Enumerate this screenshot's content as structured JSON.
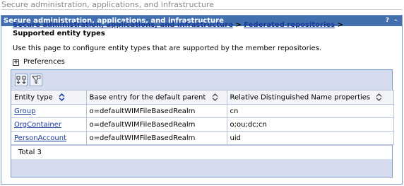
{
  "page": {
    "heading": "Secure administration, applications, and infrastructure"
  },
  "portlet": {
    "title": "Secure administration, applications, and infrastructure",
    "help_label": "?",
    "minimize_label": "–"
  },
  "breadcrumb": {
    "link1": "Secure administration, applications, and infrastructure",
    "sep1": " > ",
    "link2": "Federated repositories",
    "sep2": " > ",
    "current": "Supported entity types"
  },
  "description": "Use this page to configure entity types that are supported by the member repositories.",
  "preferences": {
    "label": "Preferences",
    "expand_symbol": "+"
  },
  "toolbar": {
    "icons": [
      "select-all-icon",
      "filter-icon"
    ]
  },
  "table": {
    "columns": [
      "Entity type",
      "Base entry for the default parent",
      "Relative Distinguished Name properties"
    ],
    "rows": [
      {
        "entity_type": "Group",
        "base_entry": "o=defaultWIMFileBasedRealm",
        "rdn": "cn"
      },
      {
        "entity_type": "OrgContainer",
        "base_entry": "o=defaultWIMFileBasedRealm",
        "rdn": "o;ou;dc;cn"
      },
      {
        "entity_type": "PersonAccount",
        "base_entry": "o=defaultWIMFileBasedRealm",
        "rdn": "uid"
      }
    ],
    "total": "Total 3"
  },
  "colors": {
    "title_bar": "#436fae",
    "link": "#1a3a9c",
    "table_frame": "#d4dcee"
  }
}
